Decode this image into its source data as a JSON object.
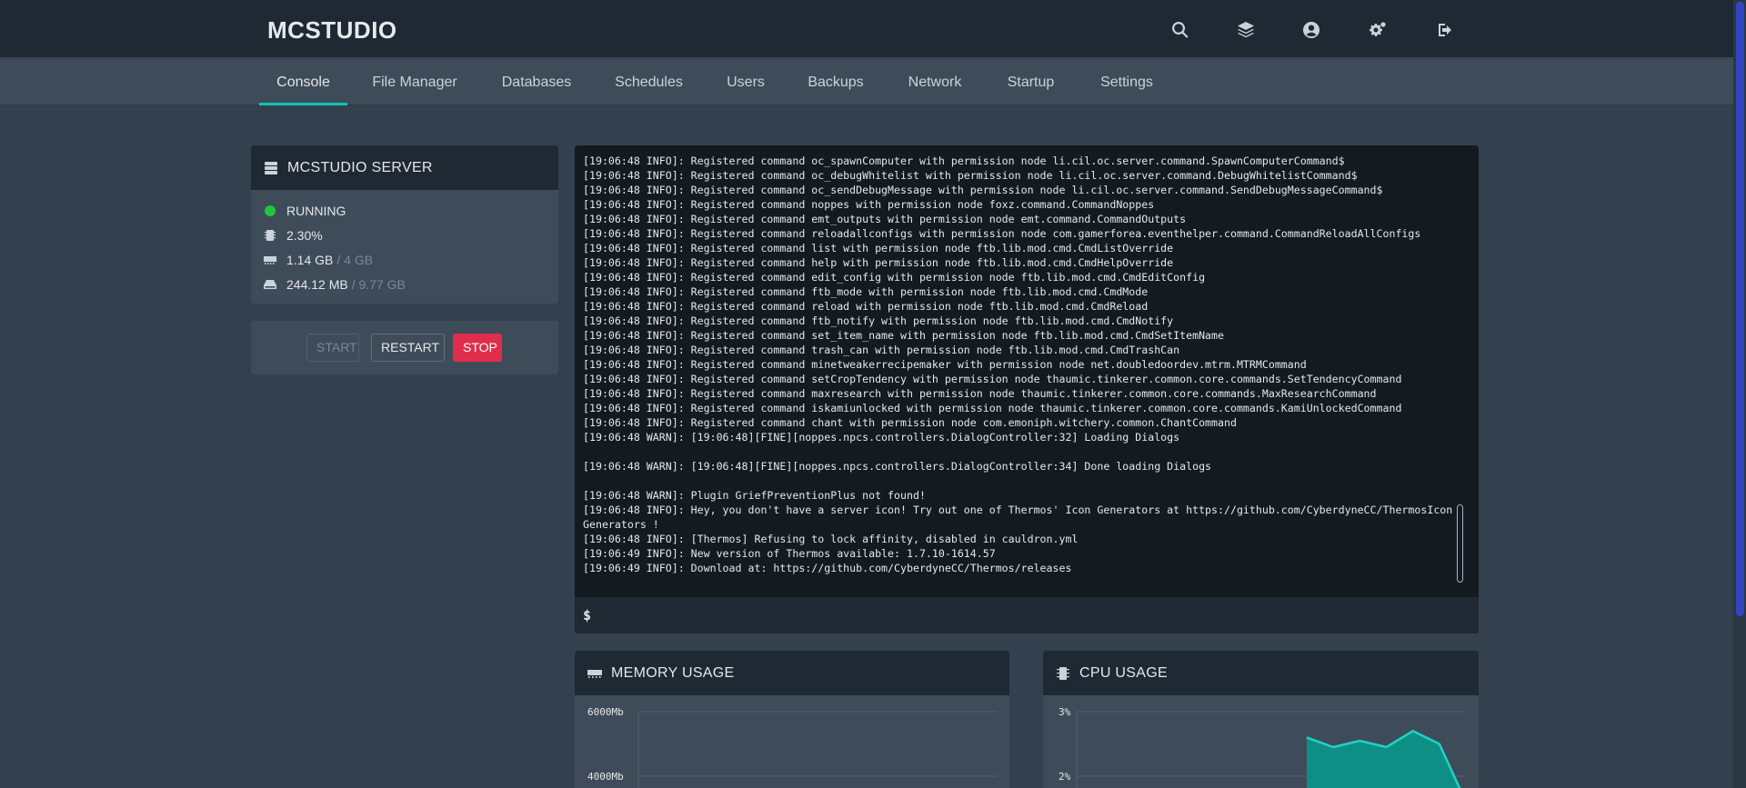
{
  "header": {
    "brand": "MCSTUDIO",
    "icons": [
      "search-icon",
      "layers-icon",
      "user-circle-icon",
      "cogs-icon",
      "sign-out-icon"
    ]
  },
  "tabs": [
    {
      "label": "Console",
      "active": true
    },
    {
      "label": "File Manager",
      "active": false
    },
    {
      "label": "Databases",
      "active": false
    },
    {
      "label": "Schedules",
      "active": false
    },
    {
      "label": "Users",
      "active": false
    },
    {
      "label": "Backups",
      "active": false
    },
    {
      "label": "Network",
      "active": false
    },
    {
      "label": "Startup",
      "active": false
    },
    {
      "label": "Settings",
      "active": false
    }
  ],
  "server": {
    "title": "MCSTUDIO SERVER",
    "status": "RUNNING",
    "status_color": "#1ec83a",
    "cpu": "2.30%",
    "memory_used": "1.14 GB",
    "memory_limit": "/ 4 GB",
    "disk_used": "244.12 MB",
    "disk_limit": "/ 9.77 GB"
  },
  "power": {
    "start": "START",
    "restart": "RESTART",
    "stop": "STOP"
  },
  "console": {
    "lines": [
      "[19:06:48 INFO]: Registered command oc_spawnComputer with permission node li.cil.oc.server.command.SpawnComputerCommand$",
      "[19:06:48 INFO]: Registered command oc_debugWhitelist with permission node li.cil.oc.server.command.DebugWhitelistCommand$",
      "[19:06:48 INFO]: Registered command oc_sendDebugMessage with permission node li.cil.oc.server.command.SendDebugMessageCommand$",
      "[19:06:48 INFO]: Registered command noppes with permission node foxz.command.CommandNoppes",
      "[19:06:48 INFO]: Registered command emt_outputs with permission node emt.command.CommandOutputs",
      "[19:06:48 INFO]: Registered command reloadallconfigs with permission node com.gamerforea.eventhelper.command.CommandReloadAllConfigs",
      "[19:06:48 INFO]: Registered command list with permission node ftb.lib.mod.cmd.CmdListOverride",
      "[19:06:48 INFO]: Registered command help with permission node ftb.lib.mod.cmd.CmdHelpOverride",
      "[19:06:48 INFO]: Registered command edit_config with permission node ftb.lib.mod.cmd.CmdEditConfig",
      "[19:06:48 INFO]: Registered command ftb_mode with permission node ftb.lib.mod.cmd.CmdMode",
      "[19:06:48 INFO]: Registered command reload with permission node ftb.lib.mod.cmd.CmdReload",
      "[19:06:48 INFO]: Registered command ftb_notify with permission node ftb.lib.mod.cmd.CmdNotify",
      "[19:06:48 INFO]: Registered command set_item_name with permission node ftb.lib.mod.cmd.CmdSetItemName",
      "[19:06:48 INFO]: Registered command trash_can with permission node ftb.lib.mod.cmd.CmdTrashCan",
      "[19:06:48 INFO]: Registered command minetweakerrecipemaker with permission node net.doubledoordev.mtrm.MTRMCommand",
      "[19:06:48 INFO]: Registered command setCropTendency with permission node thaumic.tinkerer.common.core.commands.SetTendencyCommand",
      "[19:06:48 INFO]: Registered command maxresearch with permission node thaumic.tinkerer.common.core.commands.MaxResearchCommand",
      "[19:06:48 INFO]: Registered command iskamiunlocked with permission node thaumic.tinkerer.common.core.commands.KamiUnlockedCommand",
      "[19:06:48 INFO]: Registered command chant with permission node com.emoniph.witchery.common.ChantCommand",
      "[19:06:48 WARN]: [19:06:48][FINE][noppes.npcs.controllers.DialogController:32] Loading Dialogs",
      "",
      "[19:06:48 WARN]: [19:06:48][FINE][noppes.npcs.controllers.DialogController:34] Done loading Dialogs",
      "",
      "[19:06:48 WARN]: Plugin GriefPreventionPlus not found!",
      "[19:06:48 INFO]: Hey, you don't have a server icon! Try out one of Thermos' Icon Generators at https://github.com/CyberdyneCC/ThermosIconGenerators !",
      "[19:06:48 INFO]: [Thermos] Refusing to lock affinity, disabled in cauldron.yml",
      "[19:06:49 INFO]: New version of Thermos available: 1.7.10-1614.57",
      "[19:06:49 INFO]: Download at: https://github.com/CyberdyneCC/Thermos/releases"
    ],
    "prompt": "$",
    "input_value": ""
  },
  "memory_chart": {
    "title": "MEMORY USAGE",
    "chart_data": {
      "type": "area",
      "ytick_labels": [
        "6000Mb",
        "4000Mb"
      ],
      "x": [],
      "values": []
    }
  },
  "cpu_chart": {
    "title": "CPU USAGE",
    "chart_data": {
      "type": "area",
      "ytick_labels": [
        "3%",
        "2%"
      ],
      "x": [
        0,
        1,
        2,
        3,
        4,
        5,
        6,
        7
      ],
      "values": [
        1.6,
        2.6,
        2.45,
        2.55,
        2.45,
        2.7,
        2.5,
        1.6
      ],
      "visible_from_index": 1,
      "fill_color": "#0e8f86",
      "line_color": "#1fd3c6"
    }
  }
}
